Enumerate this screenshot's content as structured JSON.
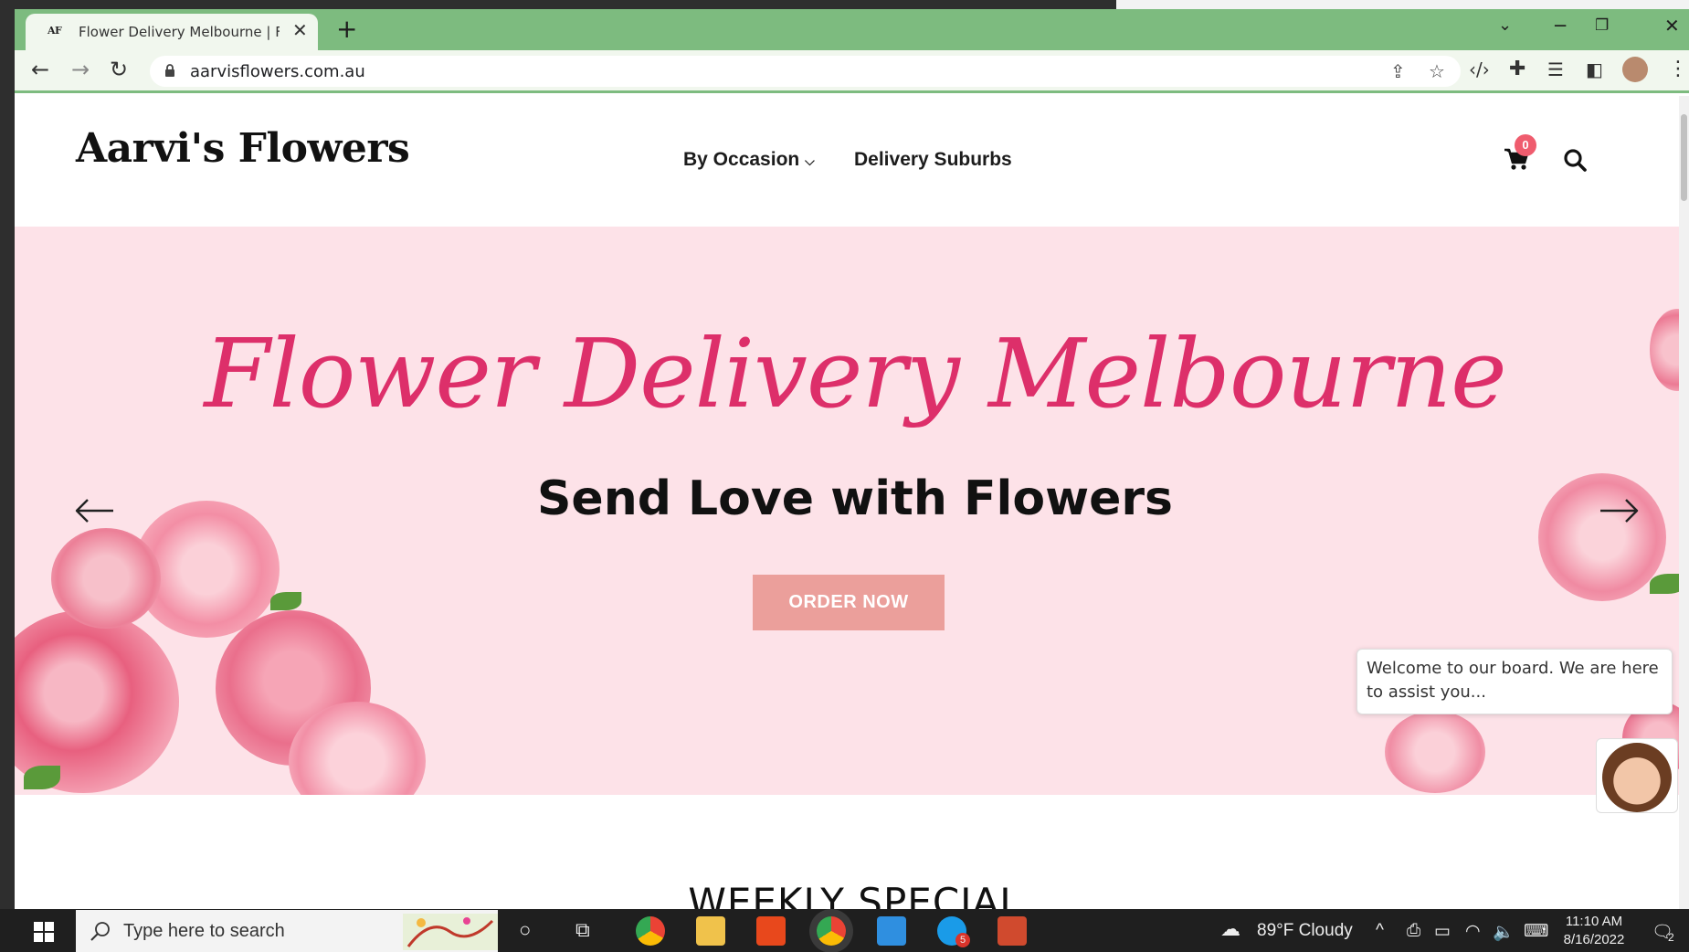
{
  "browser": {
    "tab_favicon": "AF",
    "tab_title": "Flower Delivery Melbourne | Flori",
    "tab_close_icon": "close-icon",
    "new_tab_label": "+",
    "url": "aarvisflowers.com.au",
    "theme_color": "#7dbb7f"
  },
  "site": {
    "logo": "Aarvi's Flowers",
    "nav": {
      "occasion": "By Occasion",
      "suburbs": "Delivery Suburbs"
    },
    "cart_count": "0",
    "badge_color": "#ef5c6e"
  },
  "hero": {
    "script_title": "Flower Delivery Melbourne",
    "subtitle": "Send Love with Flowers",
    "cta": "ORDER NOW",
    "background": "#fde2e8",
    "accent": "#dd2f6a",
    "button_color": "#eb9f9b"
  },
  "chat": {
    "message": "Welcome to our board. We are here to assist you..."
  },
  "section": {
    "weekly_special": "WEEKLY SPECIAL"
  },
  "taskbar": {
    "search_placeholder": "Type here to search",
    "weather": "89°F  Cloudy",
    "time": "11:10 AM",
    "date": "8/16/2022",
    "skype_badge": "5",
    "notification_count": "2"
  }
}
